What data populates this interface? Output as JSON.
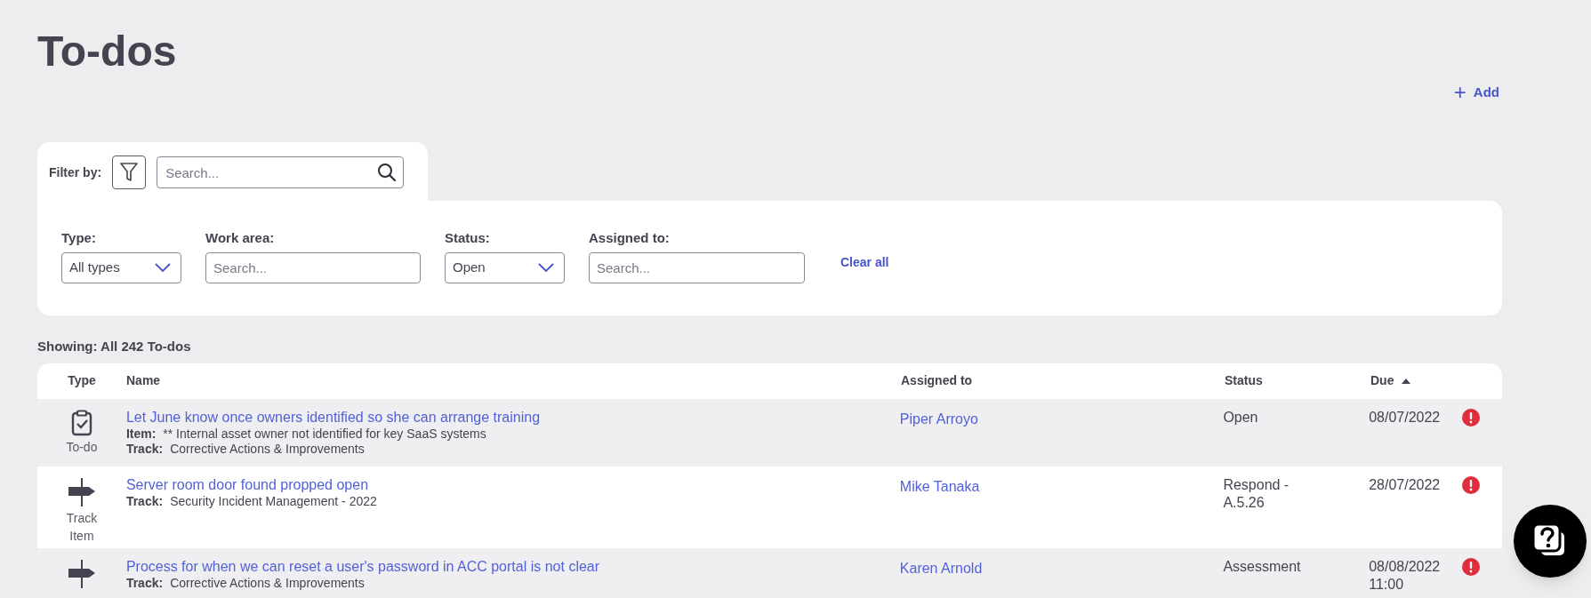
{
  "title": "To-dos",
  "add_button": {
    "icon": "+",
    "label": "Add"
  },
  "filter": {
    "label": "Filter by:",
    "search_placeholder": "Search...",
    "fields": [
      {
        "kind": "select",
        "label": "Type:",
        "value": "All types"
      },
      {
        "kind": "text",
        "label": "Work area:",
        "placeholder": "Search..."
      },
      {
        "kind": "select",
        "label": "Status:",
        "value": "Open"
      },
      {
        "kind": "text",
        "label": "Assigned to:",
        "placeholder": "Search..."
      }
    ],
    "clear_all": "Clear all"
  },
  "showing": "Showing: All 242 To-dos",
  "table": {
    "columns": [
      {
        "label": "Type",
        "sorted": false
      },
      {
        "label": "Name",
        "sorted": false
      },
      {
        "label": "Assigned to",
        "sorted": false
      },
      {
        "label": "Status",
        "sorted": false
      },
      {
        "label": "Due",
        "sorted": true
      }
    ],
    "rows": [
      {
        "kind": "todo",
        "type_label": "To-do",
        "name": "Let June know once owners identified so she can arrange training",
        "details": [
          {
            "label": "Item:",
            "value": "** Internal asset owner not identified for key SaaS systems"
          },
          {
            "label": "Track:",
            "value": "Corrective Actions & Improvements"
          }
        ],
        "assigned_to": "Piper Arroyo",
        "status": "Open",
        "due": "08/07/2022",
        "overdue": true
      },
      {
        "kind": "track_item",
        "type_label": "Track Item",
        "name": "Server room door found propped open",
        "details": [
          {
            "label": "Track:",
            "value": "Security Incident Management - 2022"
          }
        ],
        "assigned_to": "Mike Tanaka",
        "status": "Respond - A.5.26",
        "due": "28/07/2022",
        "overdue": true
      },
      {
        "kind": "track_item",
        "name": "Process for when we can reset a user's password in ACC portal is not clear",
        "details": [
          {
            "label": "Track:",
            "value": "Corrective Actions & Improvements"
          }
        ],
        "assigned_to": "Karen Arnold",
        "status": "Assessment",
        "due": "08/08/2022 11:00",
        "overdue": true
      }
    ]
  }
}
